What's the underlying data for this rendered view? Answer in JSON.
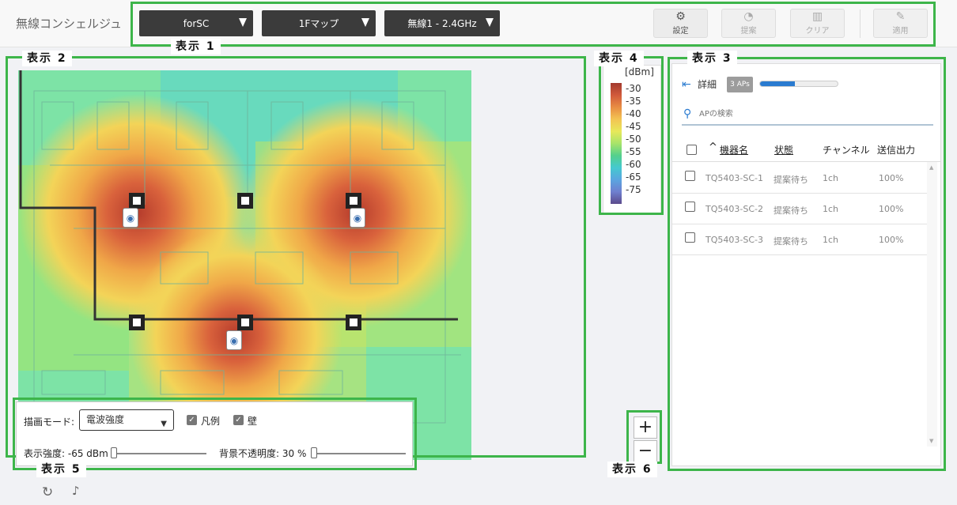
{
  "app": {
    "title": "無線コンシェルジュ"
  },
  "header": {
    "selects": [
      {
        "label": "forSC"
      },
      {
        "label": "1Fマップ"
      },
      {
        "label": "無線1 - 2.4GHz"
      }
    ],
    "buttons": [
      {
        "label": "設定",
        "icon": "gear-icon",
        "enabled": true
      },
      {
        "label": "提案",
        "icon": "lightbulb-icon",
        "enabled": false
      },
      {
        "label": "クリア",
        "icon": "trash-icon",
        "enabled": false
      },
      {
        "label": "適用",
        "icon": "wrench-icon",
        "enabled": false
      }
    ]
  },
  "annotations": {
    "d1": "表示 1",
    "d2": "表示 2",
    "d3": "表示 3",
    "d4": "表示 4",
    "d5": "表示 5",
    "d6": "表示 6"
  },
  "legend": {
    "unit": "[dBm]",
    "values": [
      "-30",
      "-35",
      "-40",
      "-45",
      "-50",
      "-55",
      "-60",
      "-65",
      "-75"
    ]
  },
  "panel": {
    "detail_label": "詳細",
    "ap_count": "3 APs",
    "progress": 0.45,
    "search_placeholder": "APの検索",
    "columns": {
      "sort": "^",
      "name": "機器名",
      "status": "状態",
      "channel": "チャンネル",
      "power": "送信出力"
    },
    "rows": [
      {
        "name": "TQ5403-SC-1",
        "status": "提案待ち",
        "channel": "1ch",
        "power": "100%"
      },
      {
        "name": "TQ5403-SC-2",
        "status": "提案待ち",
        "channel": "1ch",
        "power": "100%"
      },
      {
        "name": "TQ5403-SC-3",
        "status": "提案待ち",
        "channel": "1ch",
        "power": "100%"
      }
    ]
  },
  "controls": {
    "mode_label": "描画モード:",
    "mode_value": "電波強度",
    "legend_label": "凡例",
    "wall_label": "壁",
    "strength_label": "表示強度: -65 dBm",
    "opacity_label": "背景不透明度: 30 %"
  },
  "zoom": {
    "in": "+",
    "out": "−"
  },
  "footer": {
    "refresh_icon": "refresh-icon",
    "bell_icon": "bell-icon"
  }
}
